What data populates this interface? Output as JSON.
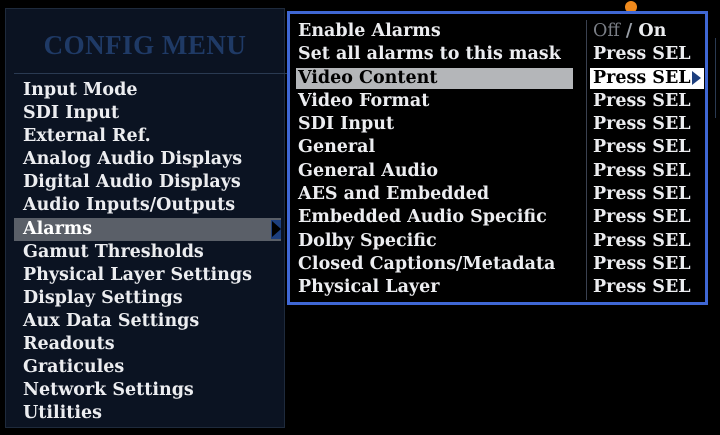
{
  "menu": {
    "title": "CONFIG MENU",
    "items": [
      {
        "label": "Input Mode"
      },
      {
        "label": "SDI Input"
      },
      {
        "label": "External Ref."
      },
      {
        "label": "Analog Audio Displays"
      },
      {
        "label": "Digital Audio Displays"
      },
      {
        "label": "Audio Inputs/Outputs"
      },
      {
        "label": "Alarms",
        "selected": true
      },
      {
        "label": "Gamut Thresholds"
      },
      {
        "label": "Physical Layer Settings"
      },
      {
        "label": "Display Settings"
      },
      {
        "label": "Aux Data Settings"
      },
      {
        "label": "Readouts"
      },
      {
        "label": "Graticules"
      },
      {
        "label": "Network Settings"
      },
      {
        "label": "Utilities"
      }
    ]
  },
  "submenu": {
    "items": [
      {
        "label": "Enable Alarms",
        "value_off": "Off",
        "value_sep": "/",
        "value_on": "On"
      },
      {
        "label": "Set all alarms to this mask",
        "value": "Press SEL"
      },
      {
        "label": "Video Content",
        "value": "Press SEL",
        "selected": true
      },
      {
        "label": "Video Format",
        "value": "Press SEL"
      },
      {
        "label": "SDI Input",
        "value": "Press SEL"
      },
      {
        "label": "General",
        "value": "Press SEL"
      },
      {
        "label": "General Audio",
        "value": "Press SEL"
      },
      {
        "label": "AES and Embedded",
        "value": "Press SEL"
      },
      {
        "label": "Embedded Audio Specific",
        "value": "Press SEL"
      },
      {
        "label": "Dolby Specific",
        "value": "Press SEL"
      },
      {
        "label": "Closed Captions/Metadata",
        "value": "Press SEL"
      },
      {
        "label": "Physical Layer",
        "value": "Press SEL"
      }
    ]
  },
  "colors": {
    "panel_border": "#3f67d4",
    "selection_arrow": "#1d3f7e",
    "indicator": "#f08a1c"
  }
}
